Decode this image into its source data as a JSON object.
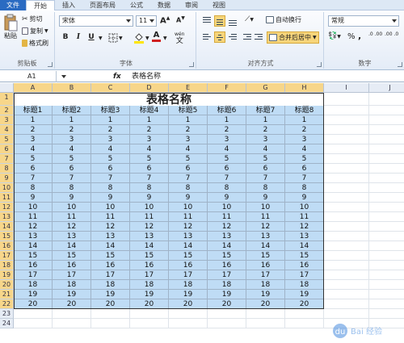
{
  "ribbon_tabs": [
    "文件",
    "开始",
    "插入",
    "页面布局",
    "公式",
    "数据",
    "审阅",
    "视图"
  ],
  "clipboard": {
    "paste": "粘贴",
    "cut": "剪切",
    "copy": "复制",
    "format_painter": "格式刷",
    "label": "剪贴板"
  },
  "font": {
    "name": "宋体",
    "size": "11",
    "label": "字体",
    "bold": "B",
    "italic": "I",
    "underline": "U",
    "font_color_letter": "A",
    "wen": "wén"
  },
  "alignment": {
    "wrap_text": "自动换行",
    "merge_center": "合并后居中",
    "label": "对齐方式"
  },
  "number": {
    "format": "常规",
    "label": "数字",
    "percent": "%",
    "comma": ",",
    "decimals_inc": ".0 .00",
    "decimals_dec": ".00 .0"
  },
  "formula_bar": {
    "name_box": "A1",
    "fx": "fx",
    "content": "表格名称"
  },
  "columns": [
    "A",
    "B",
    "C",
    "D",
    "E",
    "F",
    "G",
    "H",
    "I",
    "J"
  ],
  "rows": [
    "1",
    "2",
    "3",
    "4",
    "5",
    "6",
    "7",
    "8",
    "9",
    "10",
    "11",
    "12",
    "13",
    "14",
    "15",
    "16",
    "17",
    "18",
    "19",
    "20",
    "21",
    "22",
    "23",
    "24"
  ],
  "sheet": {
    "title": "表格名称",
    "headers": [
      "标题1",
      "标题2",
      "标题3",
      "标题4",
      "标题5",
      "标题6",
      "标题7",
      "标题8"
    ],
    "values": [
      "1",
      "2",
      "3",
      "4",
      "5",
      "6",
      "7",
      "8",
      "9",
      "10",
      "11",
      "12",
      "13",
      "14",
      "15",
      "16",
      "17",
      "18",
      "19",
      "20"
    ]
  },
  "watermark_text": "Bai 经验",
  "colors": {
    "file_tab": "#2a6bc2",
    "cell_fill": "#bfdcf5",
    "selection_header": "#f7d68a"
  }
}
